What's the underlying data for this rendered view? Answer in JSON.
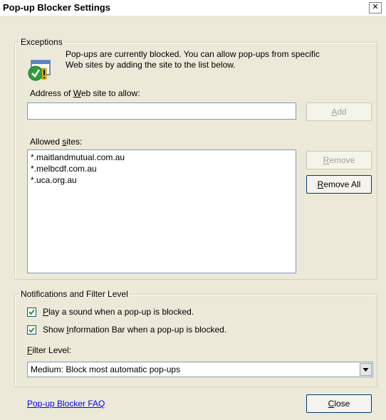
{
  "window": {
    "title": "Pop-up Blocker Settings",
    "close_glyph": "✕"
  },
  "exceptions": {
    "legend": "Exceptions",
    "info_line1": "Pop-ups are currently blocked.  You can allow pop-ups from specific",
    "info_line2": "Web sites by adding the site to the list below.",
    "address_label_pre": "Address of ",
    "address_label_ul": "W",
    "address_label_post": "eb site to allow:",
    "address_value": "",
    "add_ul": "A",
    "add_post": "dd",
    "allowed_label_pre": "Allowed ",
    "allowed_label_ul": "s",
    "allowed_label_post": "ites:",
    "allowed_sites": [
      "*.maitlandmutual.com.au",
      "*.melbcdf.com.au",
      "*.uca.org.au"
    ],
    "remove_ul": "R",
    "remove_post": "emove",
    "remove_all_ul": "R",
    "remove_all_post": "emove All"
  },
  "notifications": {
    "legend": "Notifications and Filter Level",
    "play_sound_ul": "P",
    "play_sound_post": "lay a sound when a pop-up is blocked.",
    "play_sound_checked": true,
    "info_bar_pre": "Show ",
    "info_bar_ul": "I",
    "info_bar_post": "nformation Bar when a pop-up is blocked.",
    "info_bar_checked": true,
    "filter_label_ul": "F",
    "filter_label_post": "ilter Level:",
    "filter_value": "Medium: Block most automatic pop-ups"
  },
  "footer": {
    "faq_link": "Pop-up Blocker FAQ",
    "close_ul": "C",
    "close_post": "lose"
  },
  "colors": {
    "link": "#0000ff",
    "disabled_text": "#a3a295",
    "input_border": "#7f9db9"
  },
  "icons": {
    "info": "popup-shield-icon",
    "check": "check-icon",
    "dropdown": "chevron-down-icon"
  }
}
